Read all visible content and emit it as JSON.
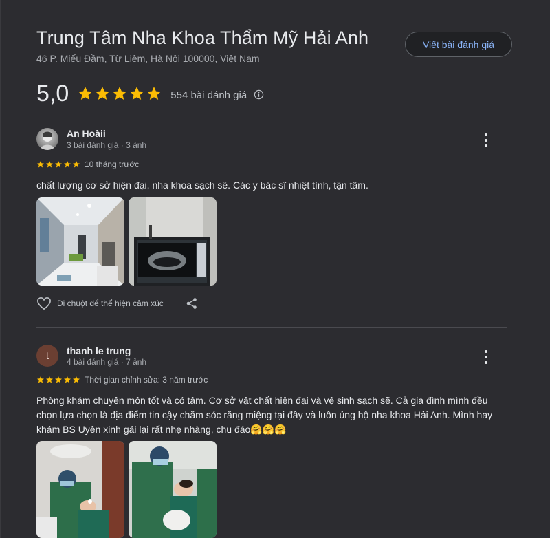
{
  "place": {
    "title": "Trung Tâm Nha Khoa Thẩm Mỹ Hải Anh",
    "address": "46 P. Miếu Đầm, Từ Liêm, Hà Nội 100000, Việt Nam",
    "write_review_label": "Viết bài đánh giá",
    "rating": "5,0",
    "rating_value": 5,
    "review_count_label": "554 bài đánh giá",
    "info_icon": "info-icon"
  },
  "colors": {
    "star": "#fbbc04",
    "link": "#8ab4f8",
    "background": "#2c2c30"
  },
  "reviews": [
    {
      "name": "An Hoàii",
      "meta": "3 bài đánh giá · 3 ảnh",
      "rating": 5,
      "time": "10 tháng trước",
      "text": "chất lượng cơ sở hiện đại, nha khoa sạch sẽ. Các y bác sĩ nhiệt tình, tận tâm.",
      "photos": [
        "clinic-hallway-photo",
        "dental-xray-monitor-photo"
      ],
      "react_label": "Di chuột để thể hiện cảm xúc"
    },
    {
      "avatar_letter": "t",
      "name": "thanh le trung",
      "meta": "4 bài đánh giá · 7 ảnh",
      "rating": 5,
      "time": "Thời gian chỉnh sửa: 3 năm trước",
      "text": "Phòng khám chuyên môn tốt và có tâm. Cơ sở vật chất hiện đại và vệ sinh sạch sẽ. Cả gia đình mình đều chọn lựa chọn là địa điểm tin cậy chăm sóc răng miệng tại đây và luôn ủng hộ nha khoa Hải Anh. Mình hay khám BS Uyên xinh gái lại rất nhẹ nhàng, chu đáo🤗🤗🤗",
      "photos": [
        "dentist-treatment-photo-1",
        "dentist-treatment-photo-2"
      ]
    }
  ]
}
